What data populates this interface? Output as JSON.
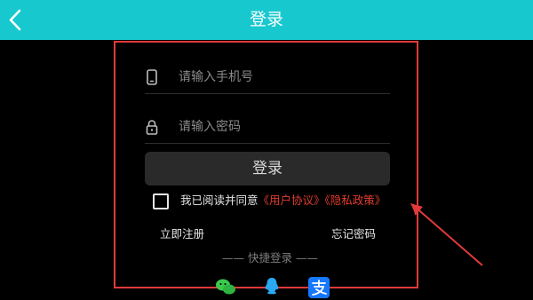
{
  "header": {
    "title": "登录",
    "back_icon": "chevron-left-icon",
    "bg_color": "#18c8cf"
  },
  "form": {
    "phone_icon": "phone-icon",
    "phone_placeholder": "请输入手机号",
    "password_icon": "lock-icon",
    "password_placeholder": "请输入密码",
    "login_label": "登录"
  },
  "agreement": {
    "prefix": "我已阅读并同意",
    "user_agreement": "《用户协议》",
    "privacy_policy": "《隐私政策》",
    "link_color": "#e23b2e"
  },
  "links": {
    "register": "立即注册",
    "forgot": "忘记密码"
  },
  "quick_login": {
    "title": "—— 快捷登录 ——",
    "items": [
      "wechat-icon",
      "qq-icon",
      "alipay-icon"
    ]
  },
  "annotation_color": "#e03a3a"
}
